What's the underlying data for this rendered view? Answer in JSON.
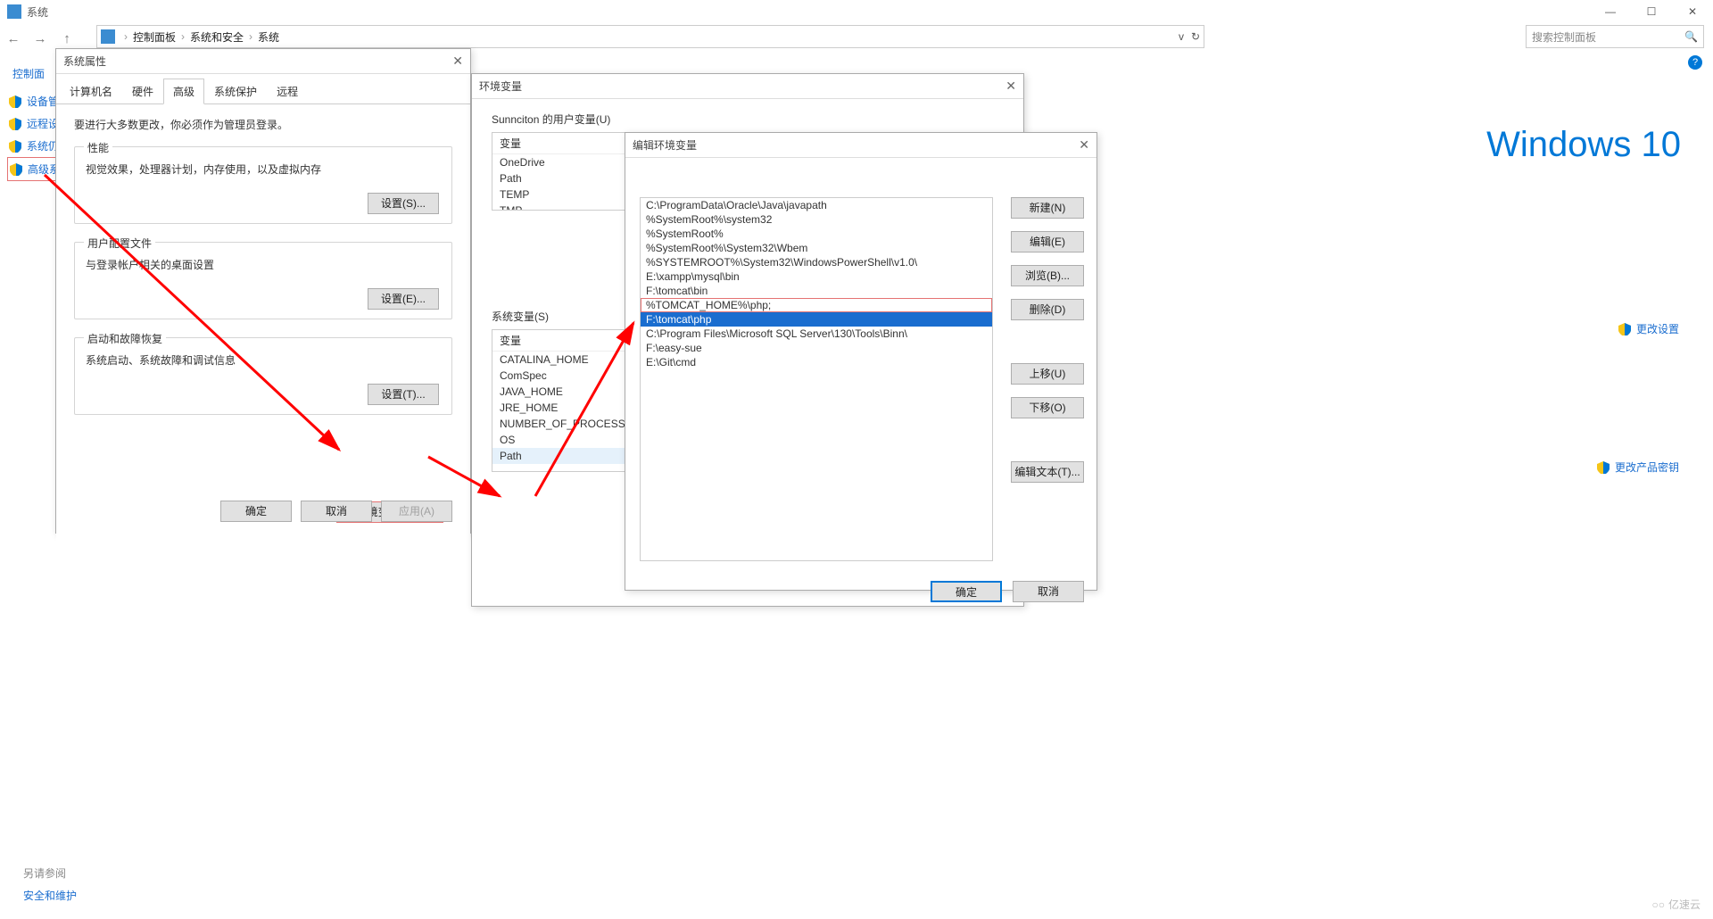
{
  "title": "系统",
  "winButtons": {
    "min": "—",
    "max": "☐",
    "close": "✕"
  },
  "breadcrumb": {
    "sep": "›",
    "items": [
      "控制面板",
      "系统和安全",
      "系统"
    ]
  },
  "addrDrop": "v",
  "addrRefresh": "↻",
  "search": {
    "placeholder": "搜索控制面板",
    "icon": "🔍"
  },
  "leftHeading": "控制面",
  "leftItems": [
    "设备管",
    "远程设",
    "系统仍",
    "高级系"
  ],
  "rightLinks": {
    "change": "更改设置",
    "key": "更改产品密钥"
  },
  "win10": "Windows 10",
  "footer": {
    "h": "另请参阅",
    "l": "安全和维护"
  },
  "watermark": "亿速云",
  "helpIcon": "?",
  "sysProps": {
    "title": "系统属性",
    "tabs": [
      "计算机名",
      "硬件",
      "高级",
      "系统保护",
      "远程"
    ],
    "activeTab": 2,
    "hint": "要进行大多数更改，你必须作为管理员登录。",
    "groups": [
      {
        "legend": "性能",
        "desc": "视觉效果，处理器计划，内存使用，以及虚拟内存",
        "btn": "设置(S)..."
      },
      {
        "legend": "用户配置文件",
        "desc": "与登录帐户相关的桌面设置",
        "btn": "设置(E)..."
      },
      {
        "legend": "启动和故障恢复",
        "desc": "系统启动、系统故障和调试信息",
        "btn": "设置(T)..."
      }
    ],
    "envBtn": "环境变量(N)...",
    "ok": "确定",
    "cancel": "取消",
    "apply": "应用(A)"
  },
  "envDlg": {
    "title": "环境变量",
    "userLabel": "Sunnciton 的用户变量(U)",
    "header": "变量",
    "userVars": [
      "OneDrive",
      "Path",
      "TEMP",
      "TMP"
    ],
    "sysLabel": "系统变量(S)",
    "sysVars": [
      "CATALINA_HOME",
      "ComSpec",
      "JAVA_HOME",
      "JRE_HOME",
      "NUMBER_OF_PROCESSO",
      "OS",
      "Path"
    ]
  },
  "editDlg": {
    "title": "编辑环境变量",
    "rows": [
      "C:\\ProgramData\\Oracle\\Java\\javapath",
      "%SystemRoot%\\system32",
      "%SystemRoot%",
      "%SystemRoot%\\System32\\Wbem",
      "%SYSTEMROOT%\\System32\\WindowsPowerShell\\v1.0\\",
      "E:\\xampp\\mysql\\bin",
      "F:\\tomcat\\bin",
      "%TOMCAT_HOME%\\php;",
      "F:\\tomcat\\php",
      "C:\\Program Files\\Microsoft SQL Server\\130\\Tools\\Binn\\",
      "F:\\easy-sue",
      "E:\\Git\\cmd"
    ],
    "selectedIndex": 8,
    "markedIndex": 7,
    "btns": {
      "new": "新建(N)",
      "edit": "编辑(E)",
      "browse": "浏览(B)...",
      "delete": "删除(D)",
      "up": "上移(U)",
      "down": "下移(O)",
      "text": "编辑文本(T)...",
      "ok": "确定",
      "cancel": "取消"
    }
  }
}
